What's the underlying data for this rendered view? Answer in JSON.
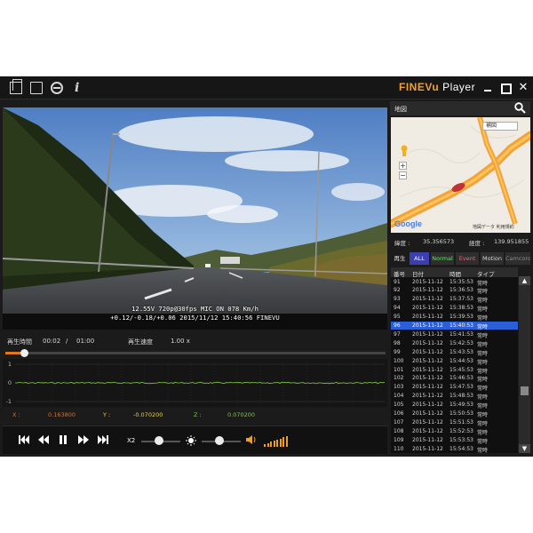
{
  "titlebar": {
    "brand_fine": "FINEVu",
    "brand_player": " Player",
    "close_glyph": "✕"
  },
  "video": {
    "osd_line1": "12.55V 720p@30fps MIC ON 078 Km/h",
    "osd_line2": "+0.12/-0.18/+0.06 2015/11/12 15:40:56 FINEVU"
  },
  "playback": {
    "elapsed_label": "再生時間",
    "elapsed": "00:02",
    "separator": "/",
    "duration": "01:00",
    "speed_label": "再生速度",
    "speed": "1.00 x",
    "progress_fraction": 0.05
  },
  "graph": {
    "axis_top": "1",
    "axis_mid": "0",
    "axis_bot": "-1",
    "x_label": "X :",
    "x_value": "0.163800",
    "y_label": "Y :",
    "y_value": "-0.070200",
    "z_label": "Z :",
    "z_value": "0.070200"
  },
  "controls": {
    "speed_label": "X2",
    "speed_fraction": 0.45,
    "brightness_fraction": 0.45,
    "volume_level": 8
  },
  "map": {
    "header": "地図",
    "layer": "補図",
    "zoom_in": "+",
    "zoom_out": "−",
    "road_label_1": "舞鶴道道",
    "road_label_2": "舞鶴道道",
    "google": "Google",
    "attribution": "地図データ  利用規約"
  },
  "coords": {
    "lat_label": "緯度 :",
    "lat": "35.356573",
    "lon_label": "経度 :",
    "lon": "139.951855"
  },
  "filters": {
    "label": "再生",
    "all": "ALL",
    "normal": "Normal",
    "event": "Event",
    "motion": "Motion",
    "camera": "Camcorder"
  },
  "table": {
    "headers": [
      "番号",
      "日付",
      "時間",
      "タイプ"
    ],
    "selected_index": 5,
    "rows": [
      [
        "91",
        "2015-11-12",
        "15:35:53",
        "常時"
      ],
      [
        "92",
        "2015-11-12",
        "15:36:53",
        "常時"
      ],
      [
        "93",
        "2015-11-12",
        "15:37:53",
        "常時"
      ],
      [
        "94",
        "2015-11-12",
        "15:38:53",
        "常時"
      ],
      [
        "95",
        "2015-11-12",
        "15:39:53",
        "常時"
      ],
      [
        "96",
        "2015-11-12",
        "15:40:53",
        "常時"
      ],
      [
        "97",
        "2015-11-12",
        "15:41:53",
        "常時"
      ],
      [
        "98",
        "2015-11-12",
        "15:42:53",
        "常時"
      ],
      [
        "99",
        "2015-11-12",
        "15:43:53",
        "常時"
      ],
      [
        "100",
        "2015-11-12",
        "15:44:53",
        "常時"
      ],
      [
        "101",
        "2015-11-12",
        "15:45:53",
        "常時"
      ],
      [
        "102",
        "2015-11-12",
        "15:46:53",
        "常時"
      ],
      [
        "103",
        "2015-11-12",
        "15:47:53",
        "常時"
      ],
      [
        "104",
        "2015-11-12",
        "15:48:53",
        "常時"
      ],
      [
        "105",
        "2015-11-12",
        "15:49:53",
        "常時"
      ],
      [
        "106",
        "2015-11-12",
        "15:50:53",
        "常時"
      ],
      [
        "107",
        "2015-11-12",
        "15:51:53",
        "常時"
      ],
      [
        "108",
        "2015-11-12",
        "15:52:53",
        "常時"
      ],
      [
        "109",
        "2015-11-12",
        "15:53:53",
        "常時"
      ],
      [
        "110",
        "2015-11-12",
        "15:54:53",
        "常時"
      ]
    ]
  },
  "colors": {
    "accent": "#f0a030",
    "selected_row": "#2a5fd8",
    "filter_all": "#3c3fb0",
    "graph_line": "#7cc840"
  },
  "icons": [
    "folder-icon",
    "window-icon",
    "gps-icon",
    "info-icon",
    "search-icon",
    "first-icon",
    "rewind-icon",
    "pause-icon",
    "forward-icon",
    "last-icon",
    "brightness-icon",
    "speaker-icon"
  ]
}
